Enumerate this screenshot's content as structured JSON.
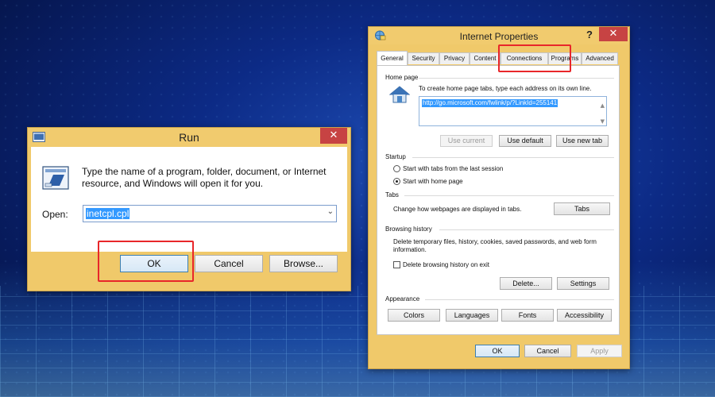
{
  "run": {
    "title": "Run",
    "description": "Type the name of a program, folder, document, or Internet resource, and Windows will open it for you.",
    "open_label": "Open:",
    "input_value": "inetcpl.cpl",
    "ok_label": "OK",
    "cancel_label": "Cancel",
    "browse_label": "Browse...",
    "close_glyph": "✕"
  },
  "ie": {
    "title": "Internet Properties",
    "help_glyph": "?",
    "close_glyph": "✕",
    "tabs": [
      {
        "label": "General"
      },
      {
        "label": "Security"
      },
      {
        "label": "Privacy"
      },
      {
        "label": "Content"
      },
      {
        "label": "Connections"
      },
      {
        "label": "Programs"
      },
      {
        "label": "Advanced"
      }
    ],
    "home_page": {
      "title": "Home page",
      "hint": "To create home page tabs, type each address on its own line.",
      "url": "http://go.microsoft.com/fwlink/p/?LinkId=255141",
      "use_current": "Use current",
      "use_default": "Use default",
      "use_new_tab": "Use new tab"
    },
    "startup": {
      "title": "Startup",
      "option1": "Start with tabs from the last session",
      "option2": "Start with home page",
      "selected": "Start with home page"
    },
    "tabs_group": {
      "title": "Tabs",
      "text": "Change how webpages are displayed in tabs.",
      "button": "Tabs"
    },
    "browsing_history": {
      "title": "Browsing history",
      "text": "Delete temporary files, history, cookies, saved passwords, and web form information.",
      "checkbox": "Delete browsing history on exit",
      "delete_btn": "Delete...",
      "settings_btn": "Settings"
    },
    "appearance": {
      "title": "Appearance",
      "colors": "Colors",
      "languages": "Languages",
      "fonts": "Fonts",
      "accessibility": "Accessibility"
    },
    "footer": {
      "ok": "OK",
      "cancel": "Cancel",
      "apply": "Apply"
    }
  },
  "highlight_color": "#e8262a"
}
